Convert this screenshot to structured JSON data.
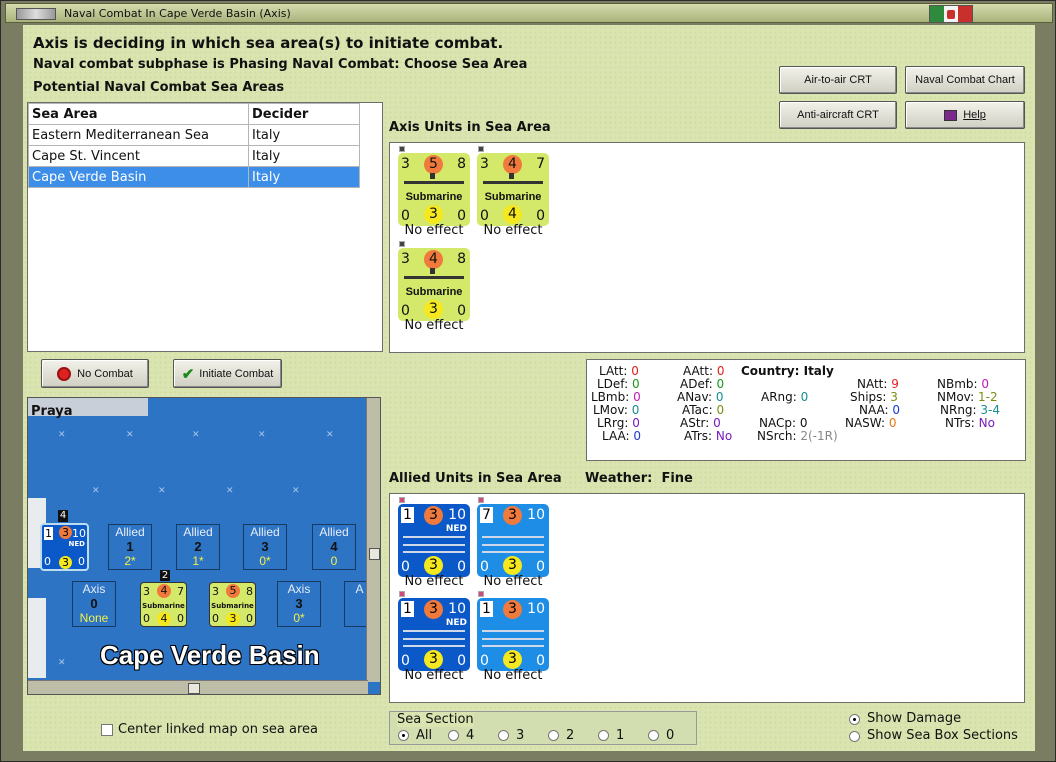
{
  "window": {
    "title": "Naval Combat In Cape Verde Basin (Axis)"
  },
  "header": {
    "line1": "Axis is deciding in which sea area(s) to initiate combat.",
    "line2": "Naval combat subphase is Phasing Naval Combat: Choose Sea Area",
    "line3": "Potential Naval Combat Sea Areas"
  },
  "buttons": {
    "air_to_air": "Air-to-air CRT",
    "naval_chart": "Naval Combat Chart",
    "anti_aircraft": "Anti-aircraft CRT",
    "help": "Help",
    "no_combat": "No Combat",
    "initiate": "Initiate Combat"
  },
  "sea_table": {
    "headers": [
      "Sea Area",
      "Decider"
    ],
    "rows": [
      {
        "area": "Eastern Mediterranean Sea",
        "decider": "Italy"
      },
      {
        "area": "Cape St. Vincent",
        "decider": "Italy"
      },
      {
        "area": "Cape Verde Basin",
        "decider": "Italy"
      }
    ]
  },
  "axis_units": {
    "title": "Axis Units in Sea Area",
    "units": [
      {
        "tl": "3",
        "tm": "5",
        "tr": "8",
        "name": "Submarine",
        "bl": "0",
        "bm": "3",
        "br": "0",
        "effect": "No effect"
      },
      {
        "tl": "3",
        "tm": "4",
        "tr": "7",
        "name": "Submarine",
        "bl": "0",
        "bm": "4",
        "br": "0",
        "effect": "No effect"
      },
      {
        "tl": "3",
        "tm": "4",
        "tr": "8",
        "name": "Submarine",
        "bl": "0",
        "bm": "3",
        "br": "0",
        "effect": "No effect"
      }
    ]
  },
  "stats": {
    "country_label": "Country:",
    "country": "Italy",
    "LAtt": "0",
    "LDef": "0",
    "LBmb": "0",
    "LMov": "0",
    "LRrg": "0",
    "LAA": "0",
    "AAtt": "0",
    "ADef": "0",
    "ANav": "0",
    "ATac": "0",
    "AStr": "0",
    "ATrs": "No",
    "ARng": "0",
    "NACp": "0",
    "NSrch": "2(-1R)",
    "NAtt": "9",
    "Ships": "3",
    "NAA": "0",
    "NASW": "0",
    "NBmb": "0",
    "NMov": "1-2",
    "NRng": "3-4",
    "NTrs": "No"
  },
  "allied_units": {
    "title": "Allied Units in Sea Area",
    "weather_label": "Weather:",
    "weather": "Fine",
    "units": [
      {
        "tl": "1",
        "tm": "3",
        "tr": "10",
        "tag": "NED",
        "bl": "0",
        "bm": "3",
        "br": "0",
        "effect": "No effect"
      },
      {
        "tl": "7",
        "tm": "3",
        "tr": "10",
        "tag": "",
        "bl": "0",
        "bm": "3",
        "br": "0",
        "effect": "No effect"
      },
      {
        "tl": "1",
        "tm": "3",
        "tr": "10",
        "tag": "NED",
        "bl": "0",
        "bm": "3",
        "br": "0",
        "effect": "No effect"
      },
      {
        "tl": "1",
        "tm": "3",
        "tr": "10",
        "tag": "",
        "bl": "0",
        "bm": "3",
        "br": "0",
        "effect": "No effect"
      }
    ]
  },
  "map": {
    "location": "Praya",
    "sea_name": "Cape Verde Basin",
    "allied_boxes": [
      {
        "side": "Allied",
        "num": "1",
        "val": "2*"
      },
      {
        "side": "Allied",
        "num": "2",
        "val": "1*"
      },
      {
        "side": "Allied",
        "num": "3",
        "val": "0*"
      },
      {
        "side": "Allied",
        "num": "4",
        "val": "0"
      }
    ],
    "axis_boxes": [
      {
        "side": "Axis",
        "num": "0",
        "val": "None"
      },
      {
        "side": "Axis",
        "num": "3",
        "val": "0*"
      }
    ],
    "stack_4": "4",
    "stack_2": "2",
    "map_unit": {
      "tl": "1",
      "tm": "3",
      "tr": "10",
      "tag": "NED",
      "bl": "0",
      "bm": "3",
      "br": "0"
    },
    "map_sub_a": {
      "tl": "3",
      "tm": "4",
      "tr": "7",
      "name": "Submarine",
      "bl": "0",
      "bm": "4",
      "br": "0"
    },
    "map_sub_b": {
      "tl": "3",
      "tm": "5",
      "tr": "8",
      "name": "Submarine",
      "bl": "0",
      "bm": "3",
      "br": "0"
    },
    "axis_partial": "A"
  },
  "controls": {
    "center_linked": "Center linked map on sea area",
    "sea_section_label": "Sea Section",
    "sections": [
      "All",
      "4",
      "3",
      "2",
      "1",
      "0"
    ],
    "show_damage": "Show Damage",
    "show_sections": "Show Sea Box Sections"
  }
}
